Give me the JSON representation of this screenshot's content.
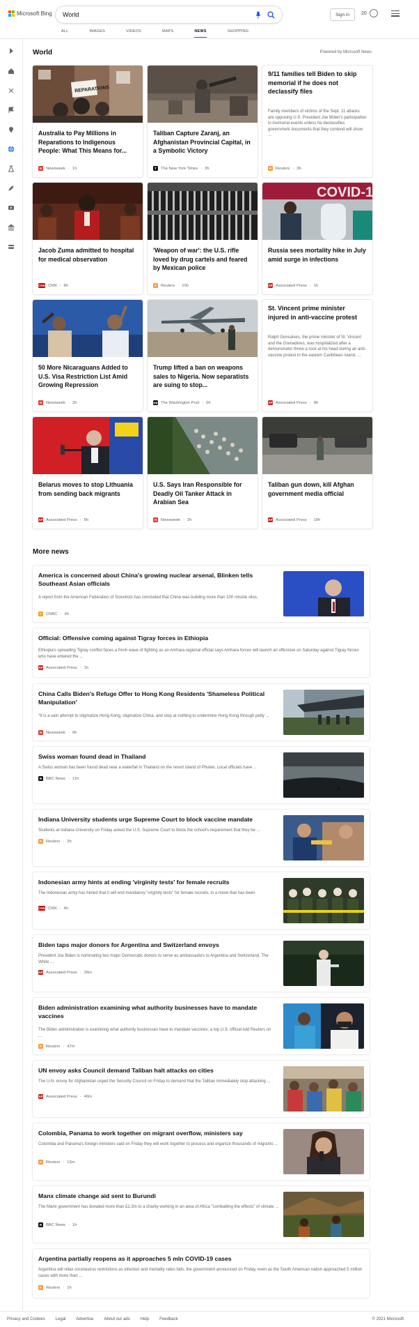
{
  "brand": {
    "name": "Microsoft Bing",
    "colors": [
      "#f25022",
      "#7fba00",
      "#00a4ef",
      "#ffb900"
    ]
  },
  "search": {
    "query": "World"
  },
  "header": {
    "signin": "Sign in",
    "points": "20"
  },
  "tabs": [
    "ALL",
    "IMAGES",
    "VIDEOS",
    "MAPS",
    "NEWS",
    "SHOPPING"
  ],
  "active_tab": "NEWS",
  "section": {
    "title": "World",
    "powered": "Powered by Microsoft News"
  },
  "cards": [
    {
      "title": "Australia to Pay Millions in Reparations to Indigenous People: What This Means for...",
      "source": "Newsweek",
      "time": "1h",
      "badge": "N",
      "badge_color": "#e53935"
    },
    {
      "title": "Taliban Capture Zaranj, an Afghanistan Provincial Capital, in a Symbolic Victory",
      "source": "The New York Times",
      "time": "3h",
      "badge": "T",
      "badge_color": "#111111"
    },
    {
      "title": "9/11 families tell Biden to skip memorial if he does not declassify files",
      "desc": "Family members of victims of the Sept. 11 attacks are opposing U.S. President Joe Biden's participation in memorial events unless he declassifies government documents that they contend will show ...",
      "source": "Reuters",
      "time": "3h",
      "badge": "R",
      "badge_color": "#f59a3a"
    },
    {
      "title": "Jacob Zuma admitted to hospital for medical observation",
      "source": "CNN",
      "time": "8h",
      "badge": "CNN",
      "badge_color": "#cc0000"
    },
    {
      "title": "'Weapon of war': the U.S. rifle loved by drug cartels and feared by Mexican police",
      "source": "Reuters",
      "time": "10h",
      "badge": "R",
      "badge_color": "#f59a3a"
    },
    {
      "title": "Russia sees mortality hike in July amid surge in infections",
      "source": "Associated Press",
      "time": "1h",
      "badge": "AP",
      "badge_color": "#cc1f1f"
    },
    {
      "title": "50 More Nicaraguans Added to U.S. Visa Restriction List Amid Growing Repression",
      "source": "Newsweek",
      "time": "2h",
      "badge": "N",
      "badge_color": "#e53935"
    },
    {
      "title": "Trump lifted a ban on weapons sales to Nigeria. Now separatists are suing to stop...",
      "source": "The Washington Post",
      "time": "5h",
      "badge": "wp",
      "badge_color": "#111111"
    },
    {
      "title": "St. Vincent prime minister injured in anti-vaccine protest",
      "desc": "Ralph Gonsalves, the prime minister of St. Vincent and the Grenadines, was hospitalized after a demonstrator threw a rock at his head during an anti-vaccine protest in the eastern Caribbean island, ...",
      "source": "Associated Press",
      "time": "8h",
      "badge": "AP",
      "badge_color": "#cc1f1f"
    },
    {
      "title": "Belarus moves to stop Lithuania from sending back migrants",
      "source": "Associated Press",
      "time": "5h",
      "badge": "AP",
      "badge_color": "#cc1f1f"
    },
    {
      "title": "U.S. Says Iran Responsible for Deadly Oil Tanker Attack in Arabian Sea",
      "source": "Newsweek",
      "time": "2h",
      "badge": "N",
      "badge_color": "#e53935"
    },
    {
      "title": "Taliban gun down, kill Afghan government media official",
      "source": "Associated Press",
      "time": "10h",
      "badge": "AP",
      "badge_color": "#cc1f1f"
    }
  ],
  "more_news_title": "More news",
  "rows": [
    {
      "title": "America is concerned about China's growing nuclear arsenal, Blinken tells Southeast Asian officials",
      "desc": "A report from the American Federation of Scientists has concluded that China was building more than 100 missile silos.",
      "source": "CNBC",
      "time": "3h",
      "badge": "C",
      "badge_color": "#f4a11e"
    },
    {
      "title": "Official: Offensive coming against Tigray forces in Ethiopia",
      "desc": "Ethiopia's spreading Tigray conflict faces a fresh wave of fighting as an Amhara regional official says Amhara forces will launch an offensive on Saturday against Tigray forces who have entered the ...",
      "source": "Associated Press",
      "time": "1h",
      "badge": "AP",
      "badge_color": "#cc1f1f"
    },
    {
      "title": "China Calls Biden's Refuge Offer to Hong Kong Residents 'Shameless Political Manipulation'",
      "desc": "\"It is a vain attempt to stigmatize Hong Kong, stigmatize China, and stop at nothing to undermine Hong Kong through petty ...",
      "source": "Newsweek",
      "time": "6h",
      "badge": "N",
      "badge_color": "#e53935"
    },
    {
      "title": "Swiss woman found dead in Thailand",
      "desc": "A Swiss woman has been found dead near a waterfall in Thailand on the resort island of Phuket. Local officials have ...",
      "source": "BBC News",
      "time": "11h",
      "badge": "B",
      "badge_color": "#111111"
    },
    {
      "title": "Indiana University students urge Supreme Court to block vaccine mandate",
      "desc": "Students at Indiana University on Friday asked the U.S. Supreme Court to block the school's requirement that they be ...",
      "source": "Reuters",
      "time": "2h",
      "badge": "R",
      "badge_color": "#f59a3a"
    },
    {
      "title": "Indonesian army hints at ending 'virginity tests' for female recruits",
      "desc": "The Indonesian army has hinted that it will end mandatory \"virginity tests\" for female recruits, in a move that has been",
      "source": "CNN",
      "time": "4h",
      "badge": "CNN",
      "badge_color": "#cc0000"
    },
    {
      "title": "Biden taps major donors for Argentina and Switzerland envoys",
      "desc": "President Joe Biden is nominating two major Democratic donors to serve as ambassadors to Argentina and Switzerland. The White ...",
      "source": "Associated Press",
      "time": "26m",
      "badge": "AP",
      "badge_color": "#cc1f1f"
    },
    {
      "title": "Biden administration examining what authority businesses have to mandate vaccines",
      "desc": "The Biden administration is examining what authority businesses have to mandate vaccines, a top U.S. official told Reuters on ...",
      "source": "Reuters",
      "time": "47m",
      "badge": "R",
      "badge_color": "#f59a3a"
    },
    {
      "title": "UN envoy asks Council demand Taliban halt attacks on cities",
      "desc": "The U.N. envoy for Afghanistan urged the Security Council on Friday to demand that the Taliban immediately stop attacking ...",
      "source": "Associated Press",
      "time": "40m",
      "badge": "AP",
      "badge_color": "#cc1f1f"
    },
    {
      "title": "Colombia, Panama to work together on migrant overflow, ministers say",
      "desc": "Colombia and Panama's foreign ministers said on Friday they will work together to process and organize thousands of migrants ...",
      "source": "Reuters",
      "time": "13m",
      "badge": "R",
      "badge_color": "#f59a3a"
    },
    {
      "title": "Manx climate change aid sent to Burundi",
      "desc": "The Manx government has donated more than £1.3m to a charity working in an area of Africa \"combatting the effects\" of climate ...",
      "source": "BBC News",
      "time": "1h",
      "badge": "B",
      "badge_color": "#111111"
    },
    {
      "title": "Argentina partially reopens as it approaches 5 mln COVID-19 cases",
      "desc": "Argentina will relax coronavirus restrictions as infection and mortality rates falls, the government announced on Friday, even as the South American nation approached 5 million cases with more than ...",
      "source": "Reuters",
      "time": "1h",
      "badge": "R",
      "badge_color": "#f59a3a"
    }
  ],
  "footer": {
    "links": [
      "Privacy and Cookies",
      "Legal",
      "Advertise",
      "About our ads",
      "Help",
      "Feedback"
    ],
    "copyright": "© 2021 Microsoft"
  }
}
